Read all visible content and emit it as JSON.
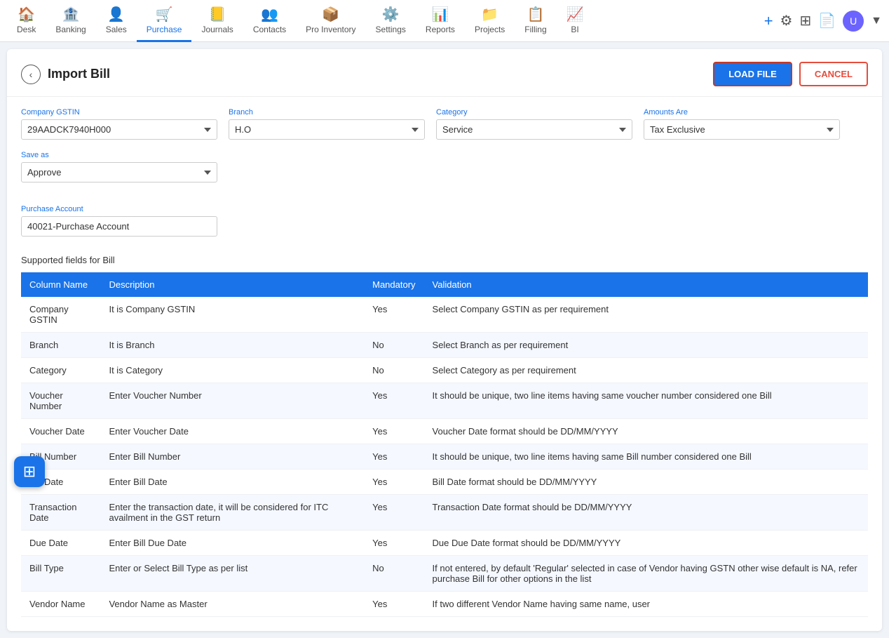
{
  "nav": {
    "items": [
      {
        "id": "desk",
        "label": "Desk",
        "icon": "🏠"
      },
      {
        "id": "banking",
        "label": "Banking",
        "icon": "🏦"
      },
      {
        "id": "sales",
        "label": "Sales",
        "icon": "👤"
      },
      {
        "id": "purchase",
        "label": "Purchase",
        "icon": "🛒",
        "active": true
      },
      {
        "id": "journals",
        "label": "Journals",
        "icon": "📒"
      },
      {
        "id": "contacts",
        "label": "Contacts",
        "icon": "👥"
      },
      {
        "id": "pro-inventory",
        "label": "Pro Inventory",
        "icon": "📦"
      },
      {
        "id": "settings",
        "label": "Settings",
        "icon": "⚙️"
      },
      {
        "id": "reports",
        "label": "Reports",
        "icon": "📊"
      },
      {
        "id": "projects",
        "label": "Projects",
        "icon": "📁"
      },
      {
        "id": "filling",
        "label": "Filling",
        "icon": "📋"
      },
      {
        "id": "bi",
        "label": "BI",
        "icon": "📈"
      }
    ]
  },
  "page": {
    "title": "Import Bill",
    "back_label": "‹"
  },
  "buttons": {
    "load_file": "LOAD FILE",
    "cancel": "CANCEL"
  },
  "form": {
    "company_gstin_label": "Company GSTIN",
    "company_gstin_value": "29AADCK7940H000",
    "branch_label": "Branch",
    "branch_value": "H.O",
    "category_label": "Category",
    "category_value": "Service",
    "amounts_are_label": "Amounts Are",
    "amounts_are_value": "Tax Exclusive",
    "save_as_label": "Save as",
    "save_as_value": "Approve",
    "purchase_account_label": "Purchase Account",
    "purchase_account_value": "40021-Purchase Account"
  },
  "table": {
    "section_title": "Supported fields for Bill",
    "headers": [
      "Column Name",
      "Description",
      "Mandatory",
      "Validation"
    ],
    "rows": [
      {
        "column_name": "Company GSTIN",
        "description": "It is Company GSTIN",
        "mandatory": "Yes",
        "validation": "Select Company GSTIN as per requirement"
      },
      {
        "column_name": "Branch",
        "description": "It is Branch",
        "mandatory": "No",
        "validation": "Select Branch as per requirement"
      },
      {
        "column_name": "Category",
        "description": "It is Category",
        "mandatory": "No",
        "validation": "Select Category as per requirement"
      },
      {
        "column_name": "Voucher Number",
        "description": "Enter Voucher Number",
        "mandatory": "Yes",
        "validation": "It should be unique, two line items having same voucher number considered one Bill"
      },
      {
        "column_name": "Voucher Date",
        "description": "Enter Voucher Date",
        "mandatory": "Yes",
        "validation": "Voucher Date format should be DD/MM/YYYY"
      },
      {
        "column_name": "Bill Number",
        "description": "Enter Bill Number",
        "mandatory": "Yes",
        "validation": "It should be unique, two line items having same Bill number considered one Bill"
      },
      {
        "column_name": "Bill Date",
        "description": "Enter Bill Date",
        "mandatory": "Yes",
        "validation": "Bill Date format should be DD/MM/YYYY"
      },
      {
        "column_name": "Transaction Date",
        "description": "Enter the transaction date, it will be considered for ITC availment in the GST return",
        "mandatory": "Yes",
        "validation": "Transaction Date format should be DD/MM/YYYY"
      },
      {
        "column_name": "Due Date",
        "description": "Enter Bill Due Date",
        "mandatory": "Yes",
        "validation": "Due Due Date format should be DD/MM/YYYY"
      },
      {
        "column_name": "Bill Type",
        "description": "Enter or Select Bill Type as per list",
        "mandatory": "No",
        "validation": "If not entered, by default 'Regular' selected in case of Vendor having GSTN other wise default is NA, refer purchase Bill for other options in the list"
      },
      {
        "column_name": "Vendor Name",
        "description": "Vendor Name as Master",
        "mandatory": "Yes",
        "validation": "If two different Vendor Name having same name, user"
      }
    ]
  }
}
